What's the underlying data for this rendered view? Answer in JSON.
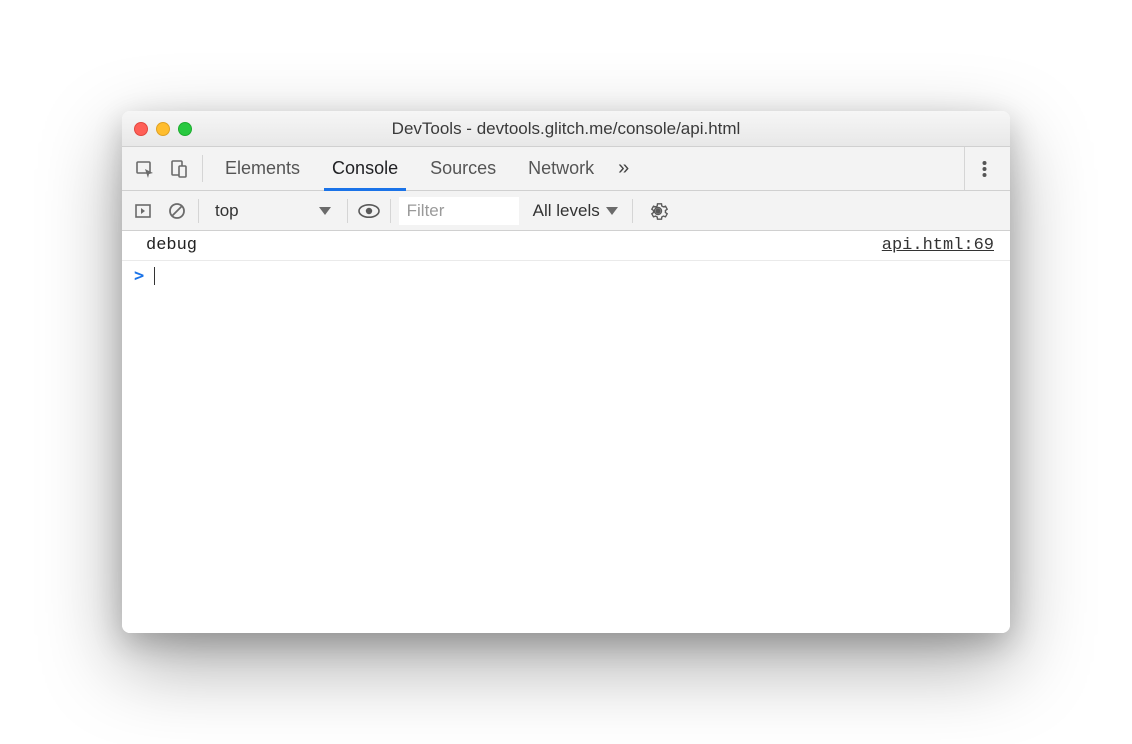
{
  "window": {
    "title": "DevTools - devtools.glitch.me/console/api.html"
  },
  "tabs": {
    "items": [
      "Elements",
      "Console",
      "Sources",
      "Network"
    ],
    "active_index": 1
  },
  "toolbar": {
    "context": "top",
    "filter_placeholder": "Filter",
    "levels_label": "All levels"
  },
  "console": {
    "logs": [
      {
        "message": "debug",
        "source": "api.html:69"
      }
    ],
    "prompt_symbol": ">"
  }
}
